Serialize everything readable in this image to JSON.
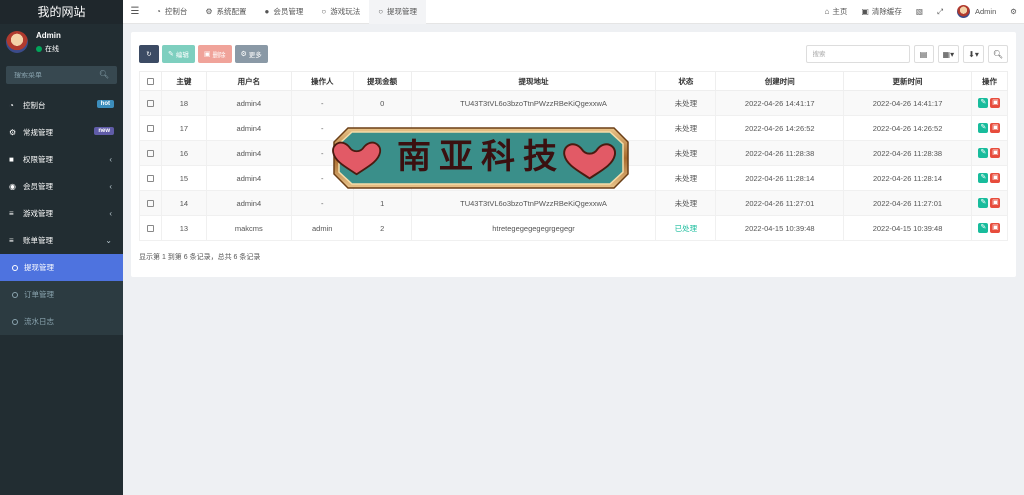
{
  "sidebar": {
    "site_title": "我的网站",
    "user_name": "Admin",
    "status": "在线",
    "search_placeholder": "搜索菜单",
    "items": [
      {
        "label": "控制台",
        "badge": "hot",
        "badge_color": "#3c8dbc"
      },
      {
        "label": "常规管理",
        "badge": "new",
        "badge_color": "#605ca8"
      },
      {
        "label": "权限管理"
      },
      {
        "label": "会员管理"
      },
      {
        "label": "游戏管理"
      },
      {
        "label": "账单管理"
      }
    ],
    "sub_items": [
      {
        "label": "提现管理",
        "active": true
      },
      {
        "label": "订单管理"
      },
      {
        "label": "流水日志"
      }
    ]
  },
  "topbar": {
    "tabs": [
      {
        "label": "控制台"
      },
      {
        "label": "系统配置"
      },
      {
        "label": "会员管理"
      },
      {
        "label": "游戏玩法"
      },
      {
        "label": "提现管理",
        "active": true
      }
    ],
    "home": "主页",
    "clear_cache": "清除缓存",
    "user_name": "Admin"
  },
  "toolbar": {
    "edit": "编辑",
    "delete": "删除",
    "more": "更多",
    "search_placeholder": "搜索"
  },
  "table": {
    "headers": [
      "主键",
      "用户名",
      "操作人",
      "提现金额",
      "提现地址",
      "状态",
      "创建时间",
      "更新时间",
      "操作"
    ],
    "rows": [
      {
        "id": "18",
        "user": "admin4",
        "operator": "-",
        "amount": "0",
        "address": "TU43T3tVL6o3bzoTtnPWzzRBeKiQgexxwA",
        "status": "未处理",
        "created": "2022-04-26 14:41:17",
        "updated": "2022-04-26 14:41:17"
      },
      {
        "id": "17",
        "user": "admin4",
        "operator": "-",
        "amount": "",
        "address": "",
        "status": "未处理",
        "created": "2022-04-26 14:26:52",
        "updated": "2022-04-26 14:26:52"
      },
      {
        "id": "16",
        "user": "admin4",
        "operator": "-",
        "amount": "",
        "address": "",
        "status": "未处理",
        "created": "2022-04-26 11:28:38",
        "updated": "2022-04-26 11:28:38"
      },
      {
        "id": "15",
        "user": "admin4",
        "operator": "-",
        "amount": "",
        "address": "",
        "status": "未处理",
        "created": "2022-04-26 11:28:14",
        "updated": "2022-04-26 11:28:14"
      },
      {
        "id": "14",
        "user": "admin4",
        "operator": "-",
        "amount": "1",
        "address": "TU43T3tVL6o3bzoTtnPWzzRBeKiQgexxwA",
        "status": "未处理",
        "created": "2022-04-26 11:27:01",
        "updated": "2022-04-26 11:27:01"
      },
      {
        "id": "13",
        "user": "makcms",
        "operator": "admin",
        "amount": "2",
        "address": "htretegegegegegrgegegr",
        "status": "已处理",
        "created": "2022-04-15 10:39:48",
        "updated": "2022-04-15 10:39:48"
      }
    ]
  },
  "summary": "显示第 1 到第 6 条记录，总共 6 条记录",
  "watermark": {
    "text": "南亚科技"
  },
  "colors": {
    "accent": "#4e73df",
    "sidebar_bg": "#222d32",
    "success": "#18bc9c",
    "danger": "#e74c3c"
  }
}
